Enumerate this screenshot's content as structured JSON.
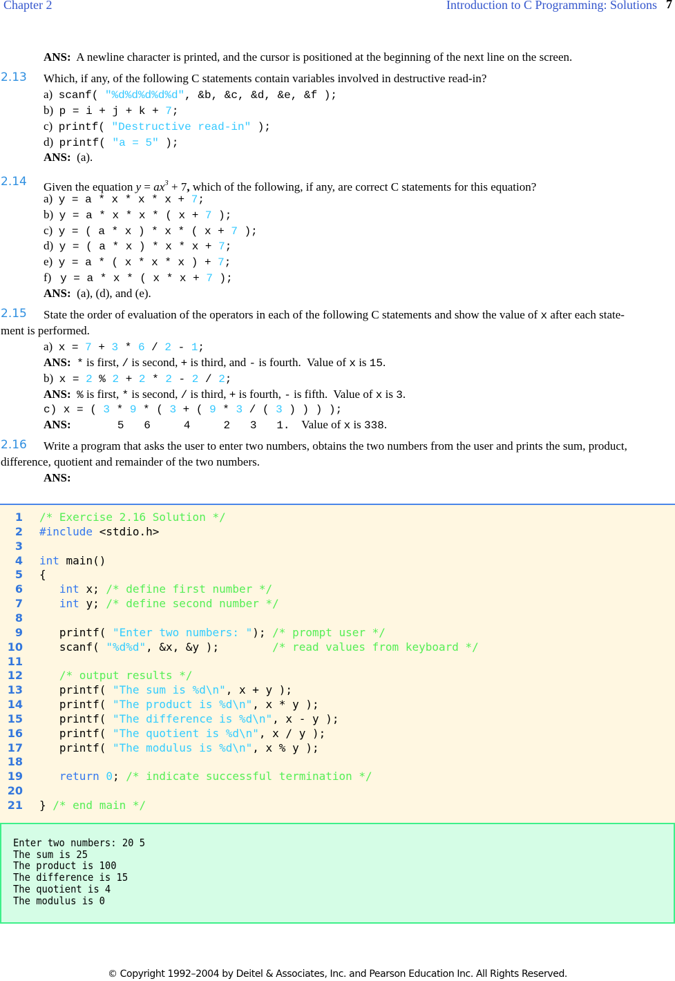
{
  "header": {
    "chapter": "Chapter 2",
    "title": "Introduction to C Programming: Solutions",
    "page": "7"
  },
  "colors": {
    "section_number": "#2f8fe0",
    "code_literal": "#33c8ff",
    "code_keyword": "#3377ee",
    "code_comment": "#55ee55",
    "code_background": "#fff7e1",
    "output_background": "#d5fde6",
    "output_border": "#3ef08a"
  },
  "lines": [
    {
      "role": "ans",
      "segs": [
        [
          "b",
          "ANS:"
        ],
        [
          "t",
          "  A newline character is printed, and the cursor is positioned at the beginning of the next line on the screen."
        ]
      ]
    },
    {
      "role": "q",
      "num": "2.13",
      "segs": [
        [
          "t",
          "Which, if any, of the following C statements contain variables involved in destructive read-in?"
        ]
      ]
    },
    {
      "role": "opt",
      "segs": [
        [
          "t",
          "a)  "
        ],
        [
          "c",
          "scanf( "
        ],
        [
          "n",
          "\"%d%d%d%d%d\""
        ],
        [
          "c",
          ", &b, &c, &d, &e, &f );"
        ]
      ]
    },
    {
      "role": "opt",
      "segs": [
        [
          "t",
          "b)  "
        ],
        [
          "c",
          "p = i + j + k + "
        ],
        [
          "n",
          "7"
        ],
        [
          "c",
          ";"
        ]
      ]
    },
    {
      "role": "opt",
      "segs": [
        [
          "t",
          "c)  "
        ],
        [
          "c",
          "printf( "
        ],
        [
          "n",
          "\"Destructive read-in\""
        ],
        [
          "c",
          " );"
        ]
      ]
    },
    {
      "role": "opt",
      "segs": [
        [
          "t",
          "d)  "
        ],
        [
          "c",
          "printf( "
        ],
        [
          "n",
          "\"a = 5\""
        ],
        [
          "c",
          " );"
        ]
      ]
    },
    {
      "role": "ans",
      "segs": [
        [
          "b",
          "ANS:"
        ],
        [
          "t",
          "  (a)."
        ]
      ]
    },
    {
      "role": "q",
      "num": "2.14",
      "segs": [
        [
          "t",
          "Given the equation "
        ],
        [
          "i",
          "y"
        ],
        [
          "t",
          " = "
        ],
        [
          "i",
          "ax"
        ],
        [
          "sup",
          "3"
        ],
        [
          "t",
          " + 7"
        ],
        [
          "b",
          ","
        ],
        [
          "t",
          " which of the following, if any, are correct C statements for this equation?"
        ]
      ]
    },
    {
      "role": "opt",
      "segs": [
        [
          "t",
          "a)  "
        ],
        [
          "c",
          "y = a * x * x * x + "
        ],
        [
          "n",
          "7"
        ],
        [
          "c",
          ";"
        ]
      ]
    },
    {
      "role": "opt",
      "segs": [
        [
          "t",
          "b)  "
        ],
        [
          "c",
          "y = a * x * x * ( x + "
        ],
        [
          "n",
          "7"
        ],
        [
          "c",
          " );"
        ]
      ]
    },
    {
      "role": "opt",
      "segs": [
        [
          "t",
          "c)  "
        ],
        [
          "c",
          "y = ( a * x ) * x * ( x + "
        ],
        [
          "n",
          "7"
        ],
        [
          "c",
          " );"
        ]
      ]
    },
    {
      "role": "opt",
      "segs": [
        [
          "t",
          "d)  "
        ],
        [
          "c",
          "y = ( a * x ) * x * x + "
        ],
        [
          "n",
          "7"
        ],
        [
          "c",
          ";"
        ]
      ]
    },
    {
      "role": "opt",
      "segs": [
        [
          "t",
          "e)  "
        ],
        [
          "c",
          "y = a * ( x * x * x ) + "
        ],
        [
          "n",
          "7"
        ],
        [
          "c",
          ";"
        ]
      ]
    },
    {
      "role": "opt",
      "segs": [
        [
          "t",
          "f)   "
        ],
        [
          "c",
          "y = a * x * ( x * x + "
        ],
        [
          "n",
          "7"
        ],
        [
          "c",
          " );"
        ]
      ]
    },
    {
      "role": "ans",
      "segs": [
        [
          "b",
          "ANS:"
        ],
        [
          "t",
          "  (a), (d), and (e)."
        ]
      ]
    },
    {
      "role": "q",
      "num": "2.15",
      "segs": [
        [
          "t",
          "State the order of evaluation of the operators in each of the following C statements and show the value of "
        ],
        [
          "c",
          "x"
        ],
        [
          "t",
          " after each state-"
        ]
      ]
    },
    {
      "role": "cont",
      "segs": [
        [
          "t",
          "ment is performed."
        ]
      ]
    },
    {
      "role": "opt",
      "segs": [
        [
          "t",
          "a)  "
        ],
        [
          "c",
          "x = "
        ],
        [
          "n",
          "7"
        ],
        [
          "c",
          " + "
        ],
        [
          "n",
          "3"
        ],
        [
          "c",
          " * "
        ],
        [
          "n",
          "6"
        ],
        [
          "c",
          " / "
        ],
        [
          "n",
          "2"
        ],
        [
          "c",
          " - "
        ],
        [
          "n",
          "1"
        ],
        [
          "c",
          ";"
        ]
      ]
    },
    {
      "role": "ans",
      "segs": [
        [
          "b",
          "ANS:"
        ],
        [
          "t",
          "  "
        ],
        [
          "c",
          "*"
        ],
        [
          "t",
          " is first, "
        ],
        [
          "c",
          "/"
        ],
        [
          "t",
          " is second, "
        ],
        [
          "c",
          "+"
        ],
        [
          "t",
          " is third, and "
        ],
        [
          "c",
          "-"
        ],
        [
          "t",
          " is fourth.  Value of "
        ],
        [
          "c",
          "x"
        ],
        [
          "t",
          " is "
        ],
        [
          "c",
          "15"
        ],
        [
          "t",
          "."
        ]
      ]
    },
    {
      "role": "opt",
      "segs": [
        [
          "t",
          "b)  "
        ],
        [
          "c",
          "x = "
        ],
        [
          "n",
          "2"
        ],
        [
          "c",
          " % "
        ],
        [
          "n",
          "2"
        ],
        [
          "c",
          " + "
        ],
        [
          "n",
          "2"
        ],
        [
          "c",
          " * "
        ],
        [
          "n",
          "2"
        ],
        [
          "c",
          " - "
        ],
        [
          "n",
          "2"
        ],
        [
          "c",
          " / "
        ],
        [
          "n",
          "2"
        ],
        [
          "c",
          ";"
        ]
      ]
    },
    {
      "role": "ans",
      "segs": [
        [
          "b",
          "ANS:"
        ],
        [
          "t",
          "  "
        ],
        [
          "c",
          "%"
        ],
        [
          "t",
          " is first, "
        ],
        [
          "c",
          "*"
        ],
        [
          "t",
          " is second, "
        ],
        [
          "c",
          "/"
        ],
        [
          "t",
          " is third, "
        ],
        [
          "c",
          "+"
        ],
        [
          "t",
          " is fourth, "
        ],
        [
          "c",
          "-"
        ],
        [
          "t",
          " is fifth.  Value of "
        ],
        [
          "c",
          "x"
        ],
        [
          "t",
          " is "
        ],
        [
          "c",
          "3"
        ],
        [
          "t",
          "."
        ]
      ]
    },
    {
      "role": "opt",
      "segs": [
        [
          "c",
          "c) x = ( "
        ],
        [
          "n",
          "3"
        ],
        [
          "c",
          " * "
        ],
        [
          "n",
          "9"
        ],
        [
          "c",
          " * ( "
        ],
        [
          "n",
          "3"
        ],
        [
          "c",
          " + ( "
        ],
        [
          "n",
          "9"
        ],
        [
          "c",
          " * "
        ],
        [
          "n",
          "3"
        ],
        [
          "c",
          " / ( "
        ],
        [
          "n",
          "3"
        ],
        [
          "c",
          " ) ) ) );"
        ]
      ]
    },
    {
      "role": "ans",
      "segs": [
        [
          "b",
          "ANS:"
        ],
        [
          "c",
          "       5   6     4     2   3   1."
        ],
        [
          "t",
          "    Value of "
        ],
        [
          "c",
          "x"
        ],
        [
          "t",
          " is "
        ],
        [
          "c",
          "338"
        ],
        [
          "t",
          "."
        ]
      ]
    },
    {
      "role": "q",
      "num": "2.16",
      "segs": [
        [
          "t",
          "Write a program that asks the user to enter two numbers, obtains the two numbers from the user and prints the sum, product,"
        ]
      ]
    },
    {
      "role": "cont",
      "segs": [
        [
          "t",
          "difference, quotient and remainder of the two numbers."
        ]
      ]
    },
    {
      "role": "ans",
      "segs": [
        [
          "b",
          "ANS:"
        ]
      ]
    }
  ],
  "code": [
    {
      "n": "1",
      "toks": [
        [
          "cm",
          "/* Exercise 2.16 Solution */"
        ]
      ]
    },
    {
      "n": "2",
      "toks": [
        [
          "k",
          "#include"
        ],
        [
          "p",
          " <stdio.h>"
        ]
      ]
    },
    {
      "n": "3",
      "toks": []
    },
    {
      "n": "4",
      "toks": [
        [
          "k",
          "int"
        ],
        [
          "p",
          " main()"
        ]
      ]
    },
    {
      "n": "5",
      "toks": [
        [
          "p",
          "{"
        ]
      ]
    },
    {
      "n": "6",
      "toks": [
        [
          "p",
          "   "
        ],
        [
          "k",
          "int"
        ],
        [
          "p",
          " x; "
        ],
        [
          "cm",
          "/* define first number */"
        ]
      ]
    },
    {
      "n": "7",
      "toks": [
        [
          "p",
          "   "
        ],
        [
          "k",
          "int"
        ],
        [
          "p",
          " y; "
        ],
        [
          "cm",
          "/* define second number */"
        ]
      ]
    },
    {
      "n": "8",
      "toks": []
    },
    {
      "n": "9",
      "toks": [
        [
          "p",
          "   printf( "
        ],
        [
          "s",
          "\"Enter two numbers: \""
        ],
        [
          "p",
          "); "
        ],
        [
          "cm",
          "/* prompt user */"
        ]
      ]
    },
    {
      "n": "10",
      "toks": [
        [
          "p",
          "   scanf( "
        ],
        [
          "s",
          "\"%d%d\""
        ],
        [
          "p",
          ", &x, &y );        "
        ],
        [
          "cm",
          "/* read values from keyboard */"
        ]
      ]
    },
    {
      "n": "11",
      "toks": []
    },
    {
      "n": "12",
      "toks": [
        [
          "p",
          "   "
        ],
        [
          "cm",
          "/* output results */"
        ]
      ]
    },
    {
      "n": "13",
      "toks": [
        [
          "p",
          "   printf( "
        ],
        [
          "s",
          "\"The sum is %d\\n\""
        ],
        [
          "p",
          ", x + y );"
        ]
      ]
    },
    {
      "n": "14",
      "toks": [
        [
          "p",
          "   printf( "
        ],
        [
          "s",
          "\"The product is %d\\n\""
        ],
        [
          "p",
          ", x * y );"
        ]
      ]
    },
    {
      "n": "15",
      "toks": [
        [
          "p",
          "   printf( "
        ],
        [
          "s",
          "\"The difference is %d\\n\""
        ],
        [
          "p",
          ", x - y );"
        ]
      ]
    },
    {
      "n": "16",
      "toks": [
        [
          "p",
          "   printf( "
        ],
        [
          "s",
          "\"The quotient is %d\\n\""
        ],
        [
          "p",
          ", x / y );"
        ]
      ]
    },
    {
      "n": "17",
      "toks": [
        [
          "p",
          "   printf( "
        ],
        [
          "s",
          "\"The modulus is %d\\n\""
        ],
        [
          "p",
          ", x % y );"
        ]
      ]
    },
    {
      "n": "18",
      "toks": []
    },
    {
      "n": "19",
      "toks": [
        [
          "p",
          "   "
        ],
        [
          "k",
          "return"
        ],
        [
          "p",
          " "
        ],
        [
          "s",
          "0"
        ],
        [
          "p",
          "; "
        ],
        [
          "cm",
          "/* indicate successful termination */"
        ]
      ]
    },
    {
      "n": "20",
      "toks": []
    },
    {
      "n": "21",
      "toks": [
        [
          "p",
          "} "
        ],
        [
          "cm",
          "/* end main */"
        ]
      ]
    }
  ],
  "output": [
    "Enter two numbers: 20 5",
    "The sum is 25",
    "The product is 100",
    "The difference is 15",
    "The quotient is 4",
    "The modulus is 0"
  ],
  "footer": "© Copyright 1992–2004 by Deitel & Associates, Inc. and Pearson Education Inc. All Rights Reserved."
}
